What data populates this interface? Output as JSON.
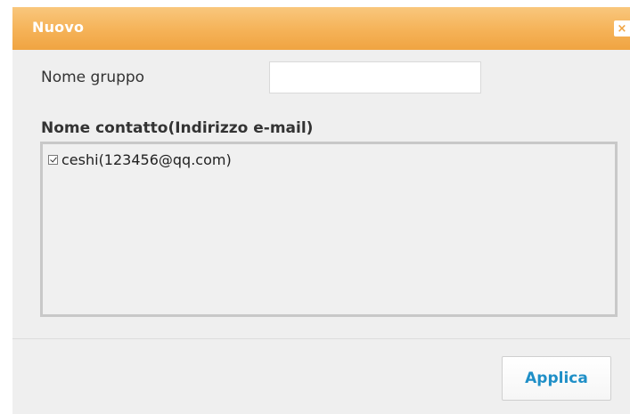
{
  "dialog": {
    "title": "Nuovo",
    "close_icon_glyph": "×",
    "accent_color": "#f5b257"
  },
  "form": {
    "group_name_label": "Nome gruppo",
    "group_name_value": "",
    "group_name_placeholder": "",
    "contact_label": "Nome contatto(Indirizzo e-mail)",
    "contacts": [
      {
        "label": "ceshi(123456@qq.com)",
        "checked": true
      }
    ]
  },
  "footer": {
    "apply_label": "Applica",
    "apply_color": "#1f8fc7"
  }
}
